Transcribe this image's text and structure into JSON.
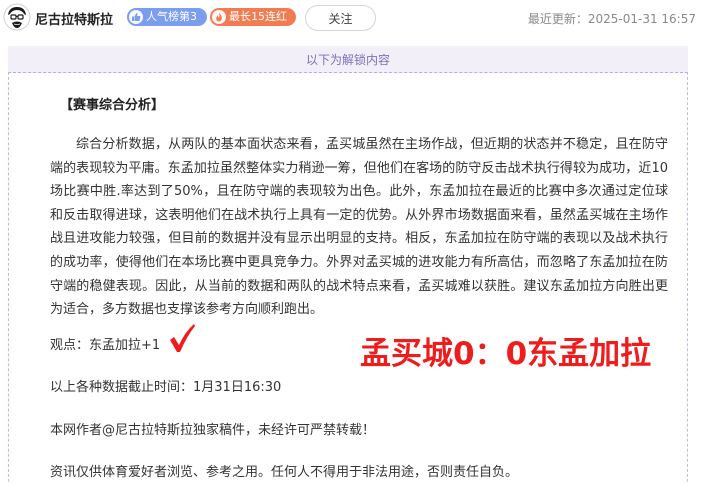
{
  "author": {
    "name": "尼古拉特斯拉",
    "avatar_icon": "cartoon-avatar-icon"
  },
  "badges": {
    "rank_label": "人气榜第3",
    "rank_icon": "thumbs-up-icon",
    "rank_color": "#7b9df0",
    "streak_label": "最长15连红",
    "streak_icon": "flame-icon",
    "streak_color": "#f27c52"
  },
  "header": {
    "follow_label": "关注",
    "last_update": "最近更新：2025-01-31 16:57"
  },
  "unlock_notice": "以下为解锁内容",
  "article": {
    "section_title": "【赛事综合分析】",
    "analysis_text": "综合分析数据，从两队的基本面状态来看，孟买城虽然在主场作战，但近期的状态并不稳定，且在防守端的表现较为平庸。东孟加拉虽然整体实力稍逊一筹，但他们在客场的防守反击战术执行得较为成功，近10场比赛中胜.率达到了50%，且在防守端的表现较为出色。此外，东孟加拉在最近的比赛中多次通过定位球和反击取得进球，这表明他们在战术执行上具有一定的优势。从外界市场数据面来看，虽然孟买城在主场作战且进攻能力较强，但目前的数据并没有显示出明显的支持。相反，东孟加拉在防守端的表现以及战术执行的成功率，使得他们在本场比赛中更具竞争力。外界对孟买城的进攻能力有所高估，而忽略了东孟加拉在防守端的稳健表现。因此，从当前的数据和两队的战术特点来看，孟买城难以获胜。建议东孟加拉方向胜出更为适合，多方数据也支撑该参考方向顺利跑出。",
    "viewpoint": "观点：东孟加拉+1",
    "check_icon": "red-checkmark-icon",
    "score_text": "孟买城0：0东孟加拉",
    "score_color": "#ee1c1c",
    "deadline": "以上各种数据截止时间：1月31日16:30",
    "copyright": "本网作者@尼古拉特斯拉独家稿件，未经许可严禁转载！",
    "disclaimer": "资讯仅供体育爱好者浏览、参考之用。任何人不得用于非法用途，否则责任自负。"
  }
}
